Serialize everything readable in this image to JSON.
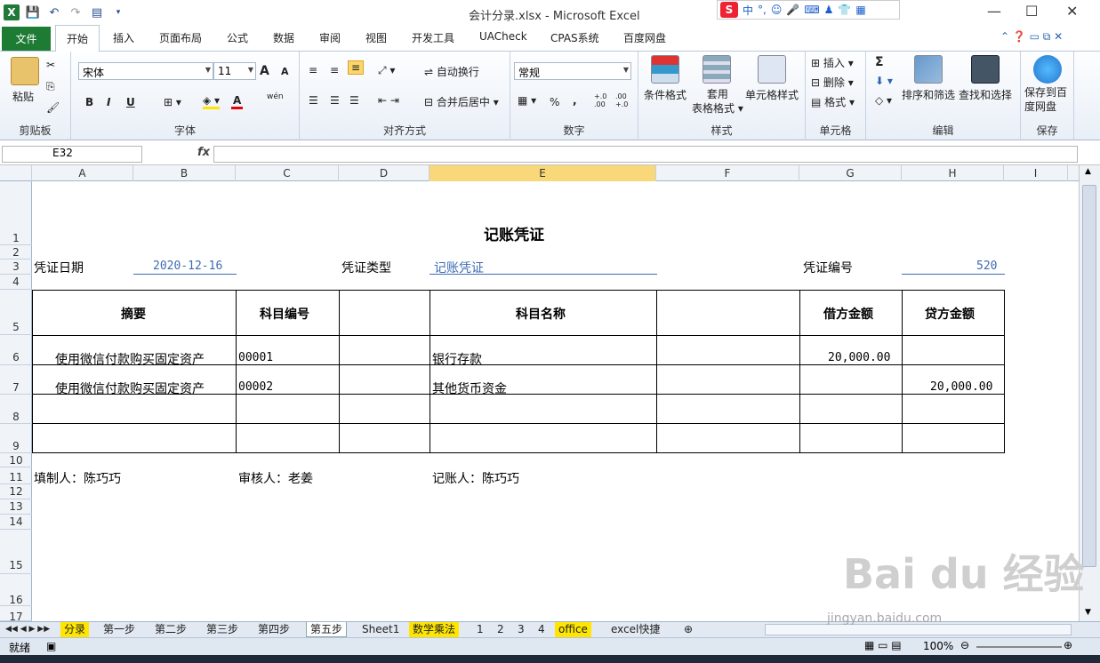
{
  "window": {
    "title": "会计分录.xlsx  -  Microsoft Excel",
    "ime_lang": "中",
    "min": "—",
    "max": "☐",
    "close": "✕"
  },
  "ribbon_tabs": [
    "文件",
    "开始",
    "插入",
    "页面布局",
    "公式",
    "数据",
    "审阅",
    "视图",
    "开发工具",
    "UACheck",
    "CPAS系统",
    "百度网盘"
  ],
  "ribbon": {
    "clipboard": {
      "paste": "粘贴",
      "label": "剪贴板"
    },
    "font": {
      "name": "宋体",
      "size": "11",
      "label": "字体",
      "bold": "B",
      "italic": "I",
      "underline": "U",
      "grow": "A",
      "shrink": "A",
      "wen": "wén",
      "color_a": "A"
    },
    "align": {
      "wrap": "自动换行",
      "merge": "合并后居中",
      "label": "对齐方式"
    },
    "number": {
      "format": "常规",
      "percent": "%",
      "comma": ",",
      "inc": "+.0 .00",
      "dec": ".00 +.0",
      "label": "数字"
    },
    "styles": {
      "cond": "条件格式",
      "table1": "套用",
      "table2": "表格格式",
      "cell": "单元格样式",
      "label": "样式"
    },
    "cells": {
      "insert": "插入",
      "delete": "删除",
      "format": "格式",
      "label": "单元格"
    },
    "edit": {
      "sum": "Σ",
      "sort": "排序和筛选",
      "find": "查找和选择",
      "label": "编辑"
    },
    "save": {
      "line1": "保存到百",
      "line2": "度网盘",
      "label": "保存"
    }
  },
  "formula": {
    "name_box": "E32",
    "fx": "fx",
    "value": ""
  },
  "columns": [
    "A",
    "B",
    "C",
    "D",
    "E",
    "F",
    "G",
    "H",
    "I"
  ],
  "selected_column": "E",
  "rows": [
    "1",
    "2",
    "3",
    "4",
    "5",
    "6",
    "7",
    "8",
    "9",
    "10",
    "11",
    "12",
    "13",
    "14",
    "15",
    "16",
    "17"
  ],
  "voucher": {
    "title": "记账凭证",
    "date_label": "凭证日期",
    "date_value": "2020-12-16",
    "type_label": "凭证类型",
    "type_value": "记账凭证",
    "no_label": "凭证编号",
    "no_value": "520",
    "headers": {
      "summary": "摘要",
      "code": "科目编号",
      "name": "科目名称",
      "debit": "借方金额",
      "credit": "贷方金额"
    },
    "entries": [
      {
        "summary": "使用微信付款购买固定资产",
        "code": "00001",
        "name": "银行存款",
        "debit": "20,000.00",
        "credit": ""
      },
      {
        "summary": "使用微信付款购买固定资产",
        "code": "00002",
        "name": "其他货币资金",
        "debit": "",
        "credit": "20,000.00"
      }
    ],
    "preparer": "填制人：陈巧巧",
    "reviewer": "审核人：老姜",
    "bookkeeper": "记账人：陈巧巧"
  },
  "sheet_tabs": [
    "分录",
    "第一步",
    "第二步",
    "第三步",
    "第四步",
    "第五步",
    "Sheet1",
    "数学乘法",
    "1",
    "2",
    "3",
    "4",
    "office",
    "excel快捷"
  ],
  "status": {
    "ready": "就绪",
    "zoom": "100%"
  },
  "watermark": {
    "brand": "Bai du 经验",
    "url": "jingyan.baidu.com"
  }
}
